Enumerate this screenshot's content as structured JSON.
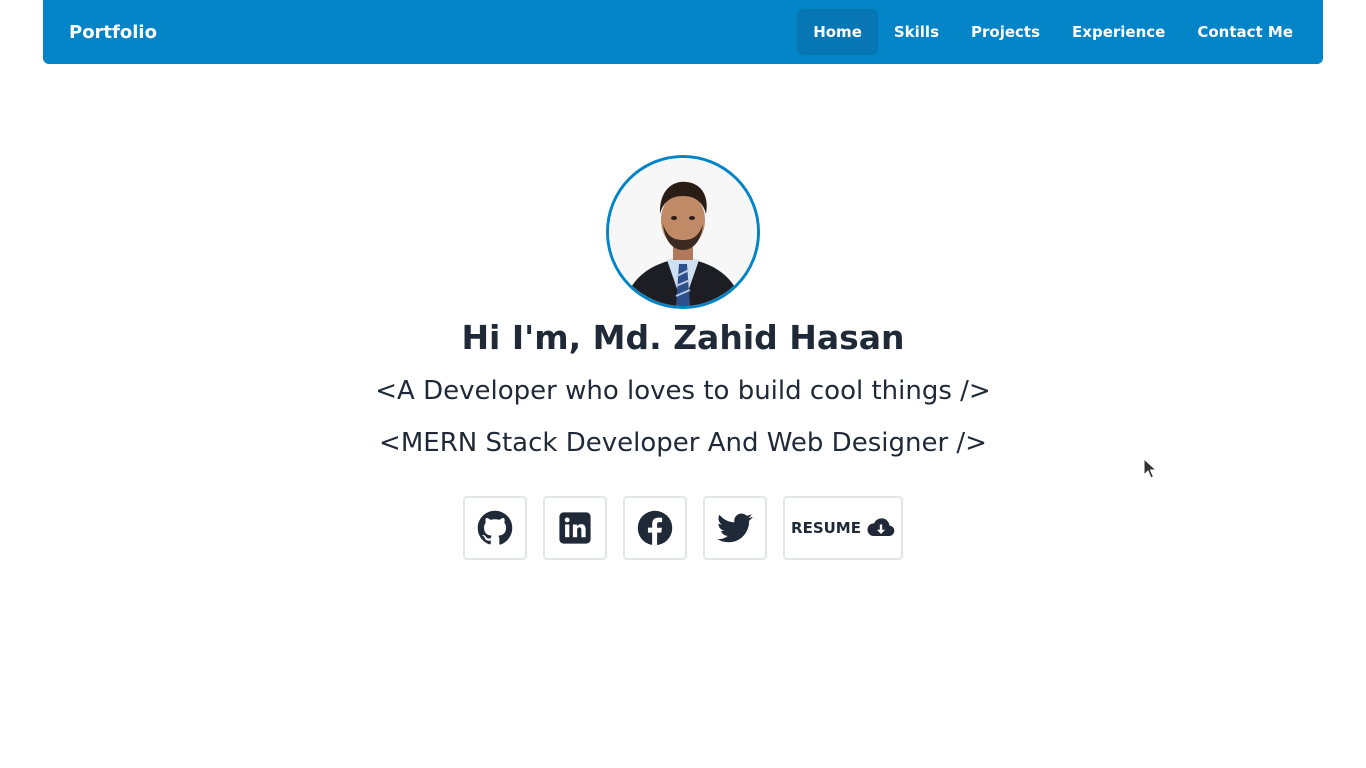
{
  "navbar": {
    "brand": "Portfolio",
    "links": [
      {
        "label": "Home",
        "active": true
      },
      {
        "label": "Skills",
        "active": false
      },
      {
        "label": "Projects",
        "active": false
      },
      {
        "label": "Experience",
        "active": false
      },
      {
        "label": "Contact Me",
        "active": false
      }
    ]
  },
  "hero": {
    "greeting": "Hi I'm, Md. Zahid Hasan",
    "tagline_1": "<A Developer who loves to build cool things />",
    "tagline_2": "<MERN Stack Developer And Web Designer />"
  },
  "socials": [
    {
      "icon": "github-icon"
    },
    {
      "icon": "linkedin-icon"
    },
    {
      "icon": "facebook-icon"
    },
    {
      "icon": "twitter-icon"
    }
  ],
  "resume": {
    "label": "RESUME",
    "icon": "cloud-download-icon"
  },
  "colors": {
    "primary": "#0384c6",
    "active_nav": "#0677b4",
    "text": "#1f2937",
    "border": "#e2e4e8"
  }
}
